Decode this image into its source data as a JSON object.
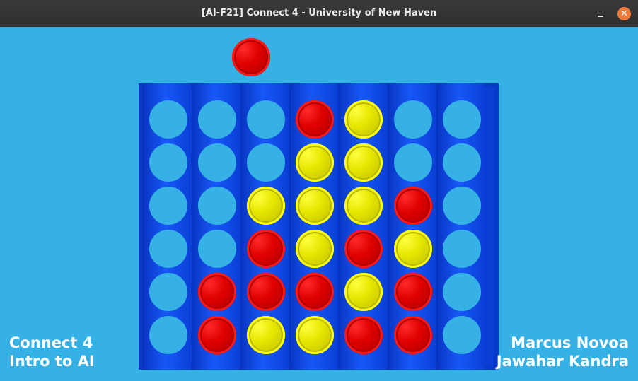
{
  "window": {
    "title": "[AI-F21] Connect 4 - University of New Haven",
    "min_icon": "minimize-icon",
    "close_icon": "close-icon",
    "close_glyph": "✕"
  },
  "game": {
    "columns": 7,
    "rows": 6,
    "hover_piece": {
      "color": "red",
      "column": 2
    },
    "board": [
      [
        "empty",
        "empty",
        "empty",
        "red",
        "yellow",
        "empty",
        "empty"
      ],
      [
        "empty",
        "empty",
        "empty",
        "yellow",
        "yellow",
        "empty",
        "empty"
      ],
      [
        "empty",
        "empty",
        "yellow",
        "yellow",
        "yellow",
        "red",
        "empty"
      ],
      [
        "empty",
        "empty",
        "red",
        "yellow",
        "red",
        "yellow",
        "empty"
      ],
      [
        "empty",
        "red",
        "red",
        "red",
        "yellow",
        "red",
        "empty"
      ],
      [
        "empty",
        "red",
        "yellow",
        "yellow",
        "red",
        "red",
        "empty"
      ]
    ],
    "colors": {
      "background": "#35b1e6",
      "board": "#0a3fd6",
      "red": "#e00000",
      "yellow": "#e6e600"
    }
  },
  "labels": {
    "left_line1": "Connect 4",
    "left_line2": "Intro to AI",
    "right_line1": "Marcus Novoa",
    "right_line2": "Jawahar Kandra"
  }
}
